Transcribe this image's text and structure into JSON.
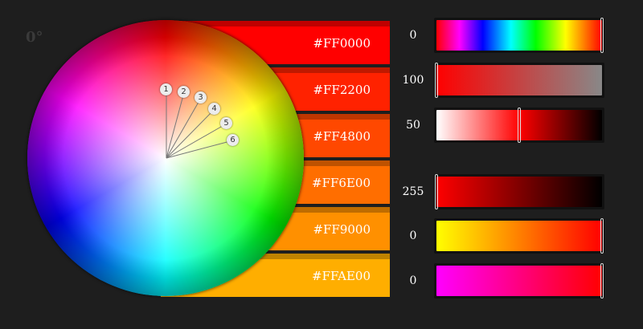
{
  "hue_angle_label": "0°",
  "swatches": [
    {
      "hex": "#FF0000",
      "color": "#FF0000"
    },
    {
      "hex": "#FF2200",
      "color": "#FF2200"
    },
    {
      "hex": "#FF4800",
      "color": "#FF4800"
    },
    {
      "hex": "#FF6E00",
      "color": "#FF6E00"
    },
    {
      "hex": "#FF9000",
      "color": "#FF9000"
    },
    {
      "hex": "#FFAE00",
      "color": "#FFAE00"
    }
  ],
  "wheel_markers": [
    "1",
    "2",
    "3",
    "4",
    "5",
    "6"
  ],
  "sliders": [
    {
      "value": "0",
      "level": 1.0,
      "gradient": "linear-gradient(to right, #ff0000, #ff00ff 14%, #0000ff 28%, #00ffff 45%, #00ff00 60%, #ffff00 78%, #ff0000)"
    },
    {
      "value": "100",
      "level": 0.0,
      "gradient": "linear-gradient(to right, #ff0000, #888888)"
    },
    {
      "value": "50",
      "level": 0.5,
      "gradient": "linear-gradient(to right, #ffffff, #ff0000 50%, #000000)"
    },
    {
      "value": "255",
      "level": 0.0,
      "gradient": "linear-gradient(to right, #ff0000, #000000)"
    },
    {
      "value": "0",
      "level": 1.0,
      "gradient": "linear-gradient(to right, #ffff00, #ff0000)"
    },
    {
      "value": "0",
      "level": 1.0,
      "gradient": "linear-gradient(to right, #ff00ff, #ff0000)"
    }
  ]
}
